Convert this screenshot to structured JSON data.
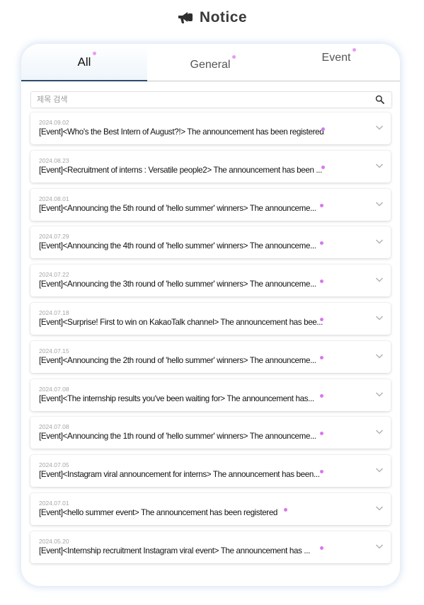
{
  "header": {
    "title": "Notice",
    "icon": "megaphone-icon"
  },
  "tabs": [
    {
      "label": "All",
      "active": true
    },
    {
      "label": "General",
      "active": false
    },
    {
      "label": "Event",
      "active": false
    }
  ],
  "search": {
    "placeholder": "제목 검색",
    "value": ""
  },
  "colors": {
    "accent_dot": "#d778f0",
    "tab_underline": "#2f4a6a",
    "card_glow": "#aac3e6"
  },
  "notices": [
    {
      "date": "2024.09.02",
      "title": "[Event]<Who's the Best Intern of August?!> The announcement has been registered"
    },
    {
      "date": "2024.08.23",
      "title": "[Event]<Recruitment of interns : Versatile people2> The announcement has been ..."
    },
    {
      "date": "2024.08.01",
      "title": "[Event]<Announcing the 5th round of 'hello summer' winners> The announceme..."
    },
    {
      "date": "2024.07.29",
      "title": "[Event]<Announcing the 4th round of 'hello summer' winners> The announceme..."
    },
    {
      "date": "2024.07.22",
      "title": "[Event]<Announcing the 3th round of 'hello summer' winners> The announceme..."
    },
    {
      "date": "2024.07.18",
      "title": "[Event]<Surprise! First to win on KakaoTalk channel> The announcement has bee..."
    },
    {
      "date": "2024.07.15",
      "title": "[Event]<Announcing the 2th round of 'hello summer' winners> The announceme..."
    },
    {
      "date": "2024.07.08",
      "title": "[Event]<The internship results you've been waiting for> The announcement has..."
    },
    {
      "date": "2024.07.08",
      "title": "[Event]<Announcing the 1th round of 'hello summer' winners> The announceme..."
    },
    {
      "date": "2024.07.05",
      "title": "[Event]<Instagram viral announcement for interns> The announcement has been..."
    },
    {
      "date": "2024.07.01",
      "title": "[Event]<hello summer event> The announcement has been registered"
    },
    {
      "date": "2024.05.20",
      "title": "[Event]<Internship recruitment Instagram viral event> The announcement has ..."
    }
  ]
}
